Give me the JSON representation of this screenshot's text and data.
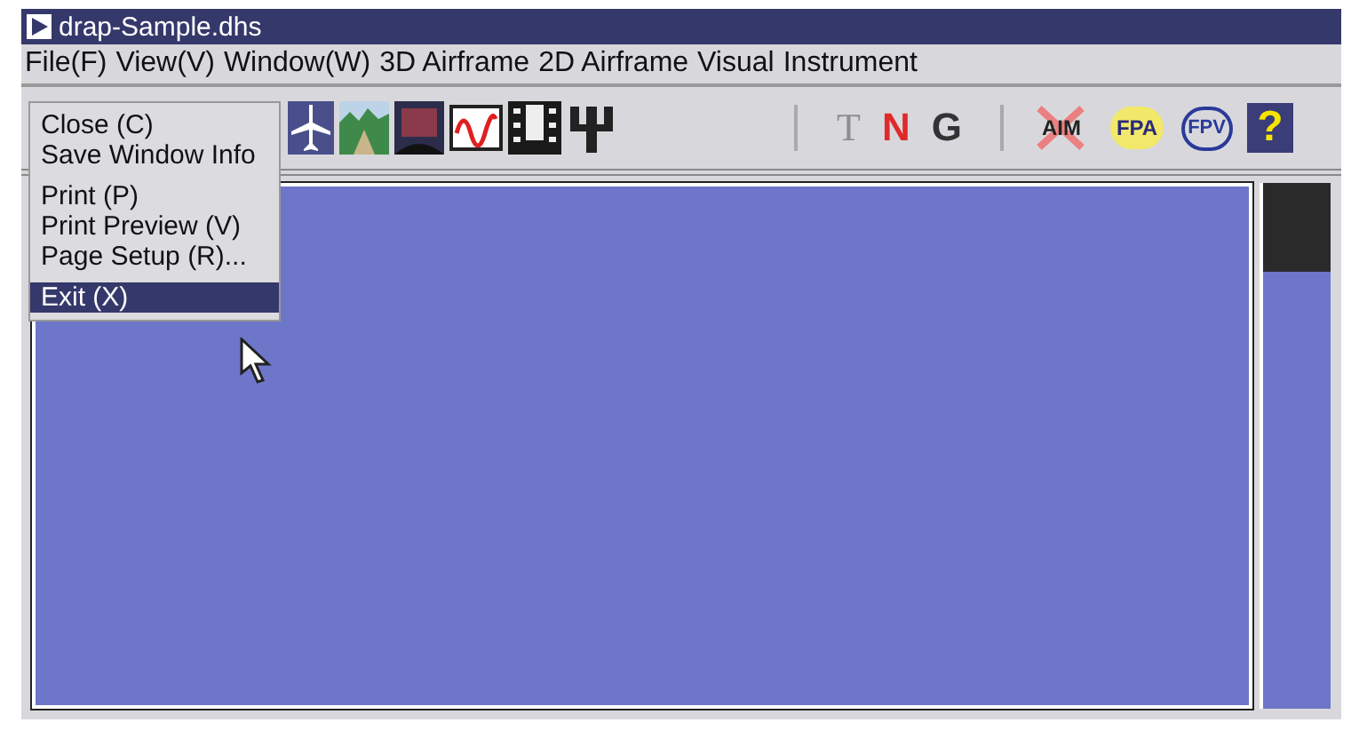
{
  "window": {
    "title": "drap-Sample.dhs"
  },
  "menu_bar": [
    {
      "label": "File(F)"
    },
    {
      "label": "View(V)"
    },
    {
      "label": "Window(W)"
    },
    {
      "label": "3D Airframe"
    },
    {
      "label": "2D Airframe"
    },
    {
      "label": "Visual"
    },
    {
      "label": "Instrument"
    }
  ],
  "file_menu": [
    {
      "kind": "item",
      "label": "Close (C)",
      "selected": false
    },
    {
      "kind": "item",
      "label": "Save Window Info",
      "selected": false
    },
    {
      "kind": "separator"
    },
    {
      "kind": "item",
      "label": "Print (P)",
      "selected": false
    },
    {
      "kind": "item",
      "label": "Print Preview (V)",
      "selected": false
    },
    {
      "kind": "item",
      "label": "Page Setup (R)...",
      "selected": false
    },
    {
      "kind": "separator"
    },
    {
      "kind": "item",
      "label": "Exit (X)",
      "selected": true
    }
  ],
  "toolbar_text_buttons": [
    {
      "kind": "letter",
      "label": "T",
      "disabled": true,
      "color": "#8e8e8e"
    },
    {
      "kind": "letter",
      "label": "N",
      "disabled": false,
      "color": "#e02a2a"
    },
    {
      "kind": "letter",
      "label": "G",
      "disabled": false,
      "color": "#333333"
    },
    {
      "kind": "separator"
    },
    {
      "kind": "aim",
      "label": "AIM"
    },
    {
      "kind": "fpa",
      "label": "FPA"
    },
    {
      "kind": "fpv",
      "label": "FPV"
    },
    {
      "kind": "help",
      "label": "?"
    }
  ]
}
